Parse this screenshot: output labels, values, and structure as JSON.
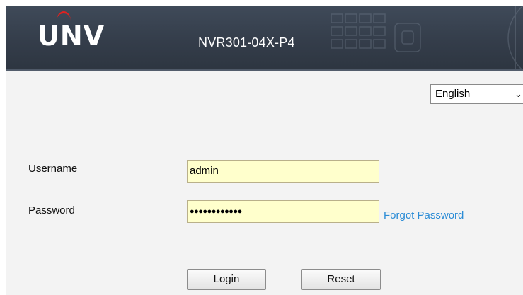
{
  "header": {
    "logo_text": "UNV",
    "model": "NVR301-04X-P4"
  },
  "language": {
    "selected": "English"
  },
  "form": {
    "username_label": "Username",
    "username_value": "admin",
    "password_label": "Password",
    "password_masked": "●●●●●●●●●●●●",
    "forgot_password": "Forgot Password"
  },
  "buttons": {
    "login": "Login",
    "reset": "Reset"
  },
  "colors": {
    "header_bg": "#39424f",
    "logo_accent": "#e0211f",
    "link": "#2b8cd6",
    "field_bg": "#ffffcc"
  }
}
